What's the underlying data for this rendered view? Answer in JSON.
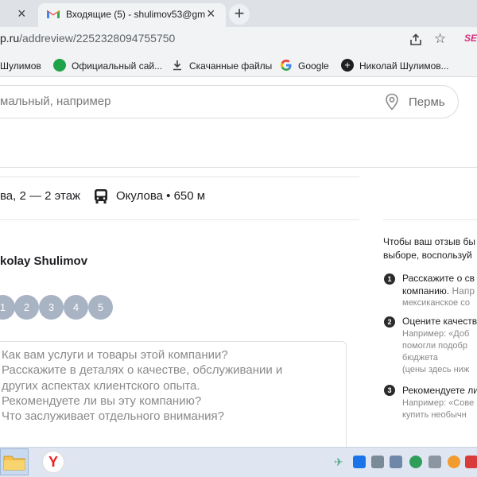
{
  "browser": {
    "tab": {
      "title": "Входящие (5) - shulimov53@gm"
    },
    "url": {
      "host": "p.ru",
      "path": "/addreview/2252328094755750"
    },
    "bookmarks": [
      {
        "label": "Шулимов",
        "icon": "bookmark-icon"
      },
      {
        "label": "Официальный сай...",
        "icon": "green-site-icon"
      },
      {
        "label": "Скачанные файлы",
        "icon": "download-icon"
      },
      {
        "label": "Google",
        "icon": "google-icon"
      },
      {
        "label": "Николай Шулимов...",
        "icon": "black-plus-icon"
      }
    ]
  },
  "page": {
    "search": {
      "placeholder": "мальный, например",
      "city": "Пермь"
    },
    "address": "ва, 2 — 2 этаж",
    "metro": {
      "station": "Окулова",
      "separator": " • ",
      "distance": "650 м"
    },
    "review": {
      "user_name": "kolay Shulimov",
      "rating_options": [
        "1",
        "2",
        "3",
        "4",
        "5"
      ],
      "textarea_placeholder_lines": [
        "Как вам услуги и товары этой компании?",
        "Расскажите в деталях о качестве, обслуживании и",
        "других аспектах клиентского опыта.",
        "Рекомендуете ли вы эту компанию?",
        "Что заслуживает отдельного внимания?"
      ]
    },
    "hints": {
      "intro_lines": [
        "Чтобы ваш отзыв бы",
        "выборе, воспользуй"
      ],
      "items": [
        {
          "number": "1",
          "title_lines": [
            "Расскажите о св",
            "компанию."
          ],
          "title_suffix": " Напр",
          "example_lines": [
            "мексиканское со"
          ]
        },
        {
          "number": "2",
          "title_lines": [
            "Оцените качеств"
          ],
          "example_lines": [
            "Например: «Доб",
            "помогли подобр",
            "бюджета",
            "(цены здесь ниж"
          ]
        },
        {
          "number": "3",
          "title_lines": [
            "Рекомендуете ли"
          ],
          "example_lines": [
            "Например: «Сове",
            "купить необычн"
          ]
        }
      ]
    }
  },
  "colors": {
    "star_button": "#a8b3c3",
    "tab_strip": "#dee1e6",
    "hint_badge": "#2b2b2b"
  }
}
